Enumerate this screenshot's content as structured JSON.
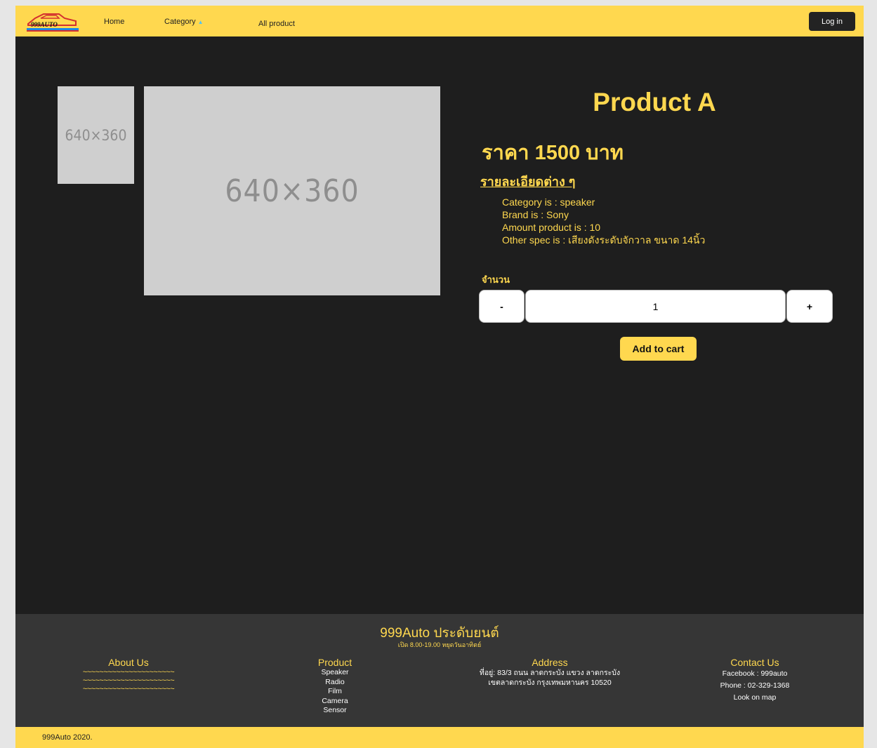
{
  "nav": {
    "logo_text": "999AUTO",
    "home": "Home",
    "category": "Category",
    "all_product": "All product",
    "login": "Log in"
  },
  "images": {
    "thumb_label": "640×360",
    "main_label": "640×360"
  },
  "product": {
    "title": "Product A",
    "price": "ราคา 1500 บาท",
    "detail_heading": "รายละเอียดต่าง ๆ",
    "specs": [
      "Category is : speaker",
      "Brand is : Sony",
      "Amount product is : 10",
      "Other spec is : เสียงดังระดับจักวาล ขนาด 14นิ้ว"
    ],
    "quantity_label": "จำนวน",
    "minus": "-",
    "quantity": "1",
    "plus": "+",
    "add_to_cart": "Add to cart"
  },
  "footer": {
    "title": "999Auto ประดับยนต์",
    "hours": "เปิด 8.00-19.00 หยุดวันอาทิตย์",
    "about": {
      "heading": "About Us",
      "lines": [
        "~~~~~~~~~~~~~~~~~~~~~~",
        "~~~~~~~~~~~~~~~~~~~~~~",
        "~~~~~~~~~~~~~~~~~~~~~~"
      ]
    },
    "product": {
      "heading": "Product",
      "items": [
        "Speaker",
        "Radio",
        "Film",
        "Camera",
        "Sensor"
      ]
    },
    "address": {
      "heading": "Address",
      "lines": [
        "ที่อยู่: 83/3 ถนน ลาดกระบัง แขวง ลาดกระบัง",
        "เขตลาดกระบัง กรุงเทพมหานคร 10520"
      ]
    },
    "contact": {
      "heading": "Contact Us",
      "facebook": "Facebook : 999auto",
      "phone": "Phone : 02-329-1368",
      "map": "Look on map"
    },
    "copyright": "999Auto 2020."
  },
  "colors": {
    "accent": "#ffd84f",
    "background": "#1e1e1e",
    "footer": "#363636"
  }
}
